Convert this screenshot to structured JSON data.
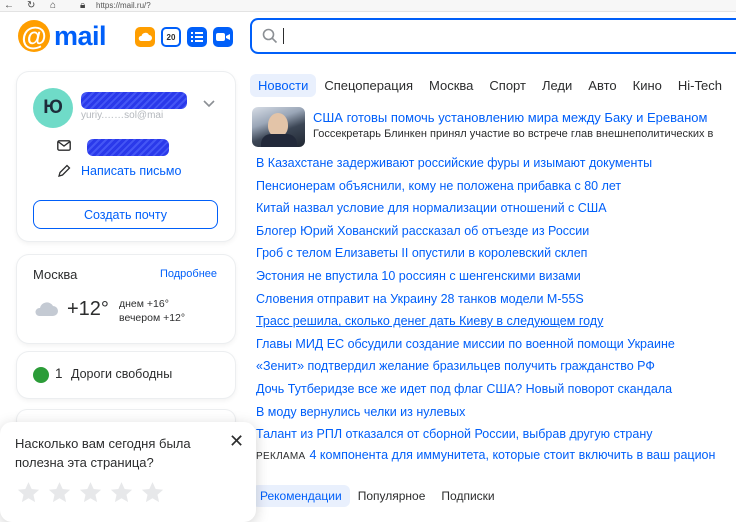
{
  "browser": {
    "url": "https://mail.ru/?"
  },
  "header": {
    "logo_text": "mail",
    "calendar_day": "20",
    "brand_color": "#005ff9",
    "logo_color": "#ff9e00"
  },
  "user": {
    "avatar_letter": "Ю",
    "email_partial": "yuriy.……sol@mai",
    "compose_label": "Написать письмо",
    "create_mail_label": "Создать почту"
  },
  "weather": {
    "city": "Москва",
    "more_label": "Подробнее",
    "temperature": "+12°",
    "day": "днем +16°",
    "evening": "вечером +12°"
  },
  "roads": {
    "score": "1",
    "label": "Дороги свободны"
  },
  "feedback": {
    "question": "Насколько вам сегодня была полезна эта страница?",
    "close_icon": "close-icon",
    "stars": [
      1,
      2,
      3,
      4,
      5
    ]
  },
  "news": {
    "tabs": [
      "Новости",
      "Спецоперация",
      "Москва",
      "Спорт",
      "Леди",
      "Авто",
      "Кино",
      "Hi-Tech"
    ],
    "top": {
      "title": "США готовы помочь установлению мира между Баку и Ереваном",
      "subtitle": "Госсекретарь Блинкен принял участие во встрече глав внешнеполитических в"
    },
    "items": [
      "В Казахстане задерживают российские фуры и изымают документы",
      "Пенсионерам объяснили, кому не положена прибавка с 80 лет",
      "Китай назвал условие для нормализации отношений с США",
      "Блогер Юрий Хованский рассказал об отъезде из России",
      "Гроб с телом Елизаветы II опустили в королевский склеп",
      "Эстония не впустила 10 россиян с шенгенскими визами",
      "Словения отправит на Украину 28 танков модели М-55S",
      "Трасс решила, сколько денег дать Киеву в следующем году",
      "Главы МИД ЕС обсудили создание миссии по военной помощи Украине",
      "«Зенит» подтвердил желание бразильцев получить гражданство РФ",
      "Дочь Тутберидзе все же идет под флаг США? Новый поворот скандала",
      "В моду вернулись челки из нулевых",
      "Талант из РПЛ отказался от сборной России, выбрав другую страну"
    ],
    "ad_label": "РЕКЛАМА",
    "ad_text": "4 компонента для иммунитета, которые стоит включить в ваш рацион"
  },
  "bottom_tabs": [
    "Рекомендации",
    "Популярное",
    "Подписки"
  ]
}
